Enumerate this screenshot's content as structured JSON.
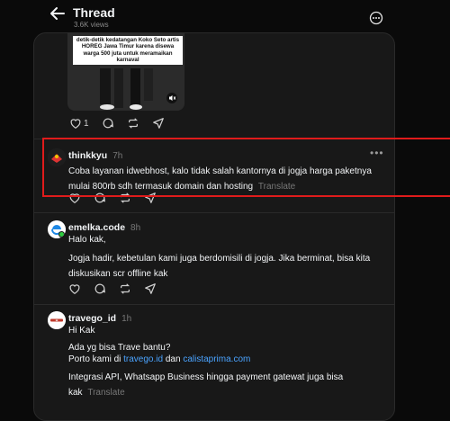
{
  "header": {
    "title": "Thread",
    "views": "3.6K views"
  },
  "media": {
    "caption": "detik-detik kedatangan Koko Seto artis HOREG Jawa Timur karena disewa warga 500 juta untuk meramaikan karnaval"
  },
  "first_post_actions": {
    "like_count": "1"
  },
  "replies": [
    {
      "username": "thinkkyu",
      "time": "7h",
      "text": "Coba layanan idwebhost, kalo tidak salah kantornya di jogja harga paketnya mulai 800rb sdh termasuk domain dan hosting",
      "translate": "Translate"
    },
    {
      "username": "emelka.code",
      "time": "8h",
      "lines": [
        "Halo kak,",
        "Jogja hadir, kebetulan kami juga berdomisili di jogja. Jika berminat, bisa kita diskusikan scr offline kak"
      ]
    },
    {
      "username": "travego_id",
      "time": "1h",
      "line1": "Hi Kak",
      "line2": "Ada yg bisa Trave bantu?",
      "line3_prefix": "Porto kami di ",
      "link1": "travego.id",
      "line3_mid": " dan ",
      "link2": "calistaprima.com",
      "line4": "Integrasi API, Whatsapp Business hingga payment gatewat juga bisa kak",
      "translate": "Translate"
    }
  ],
  "colors": {
    "highlight": "#e01b1b",
    "link": "#4aa3ff"
  }
}
